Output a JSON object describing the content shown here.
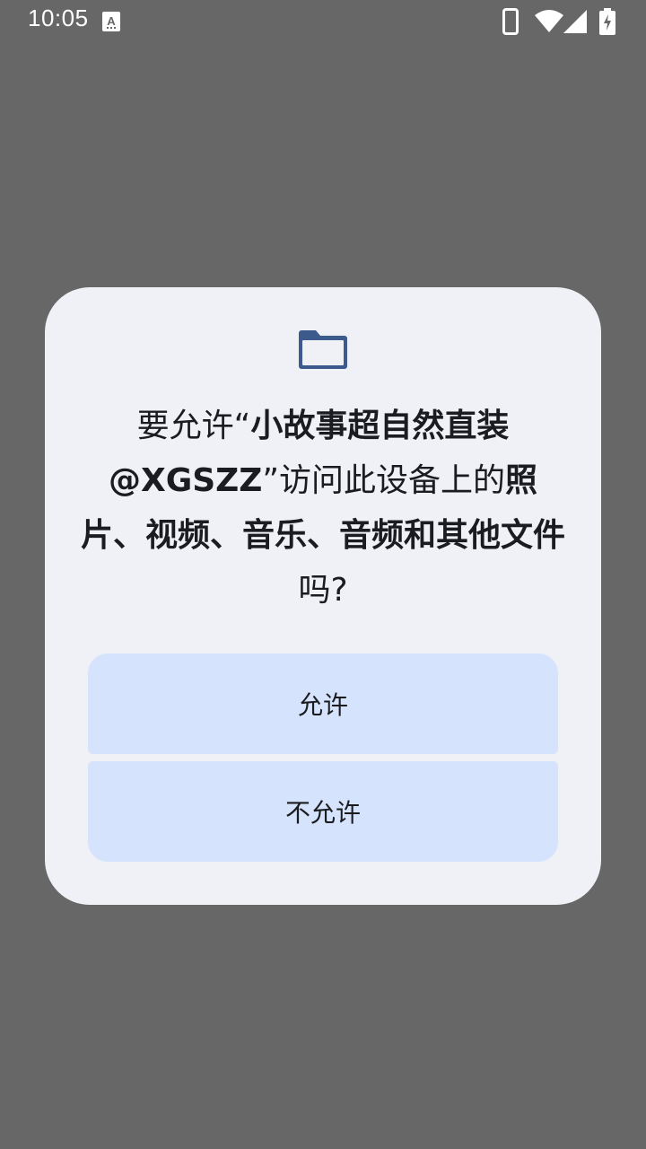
{
  "status_bar": {
    "time": "10:05",
    "notification_icon": "text-a-icon",
    "right_icons": [
      "phone-icon",
      "wifi-icon",
      "cellular-signal-icon",
      "battery-charging-icon"
    ]
  },
  "dialog": {
    "icon": "folder-icon",
    "message": {
      "part1": "要允许“",
      "app_name_line1": "小故事超自然直装",
      "app_name_line2": "@XGSZZ",
      "part2": "”访问此设备上的",
      "bold_resources": "照片、视频、音乐、音频和其他文件",
      "part3": "吗?"
    },
    "allow_label": "允许",
    "deny_label": "不允许"
  },
  "colors": {
    "scrim": "#676767",
    "dialog_bg": "#eff1f7",
    "button_bg": "#d6e3fc",
    "icon_color": "#3c5a8c",
    "text": "#1b1c20"
  }
}
